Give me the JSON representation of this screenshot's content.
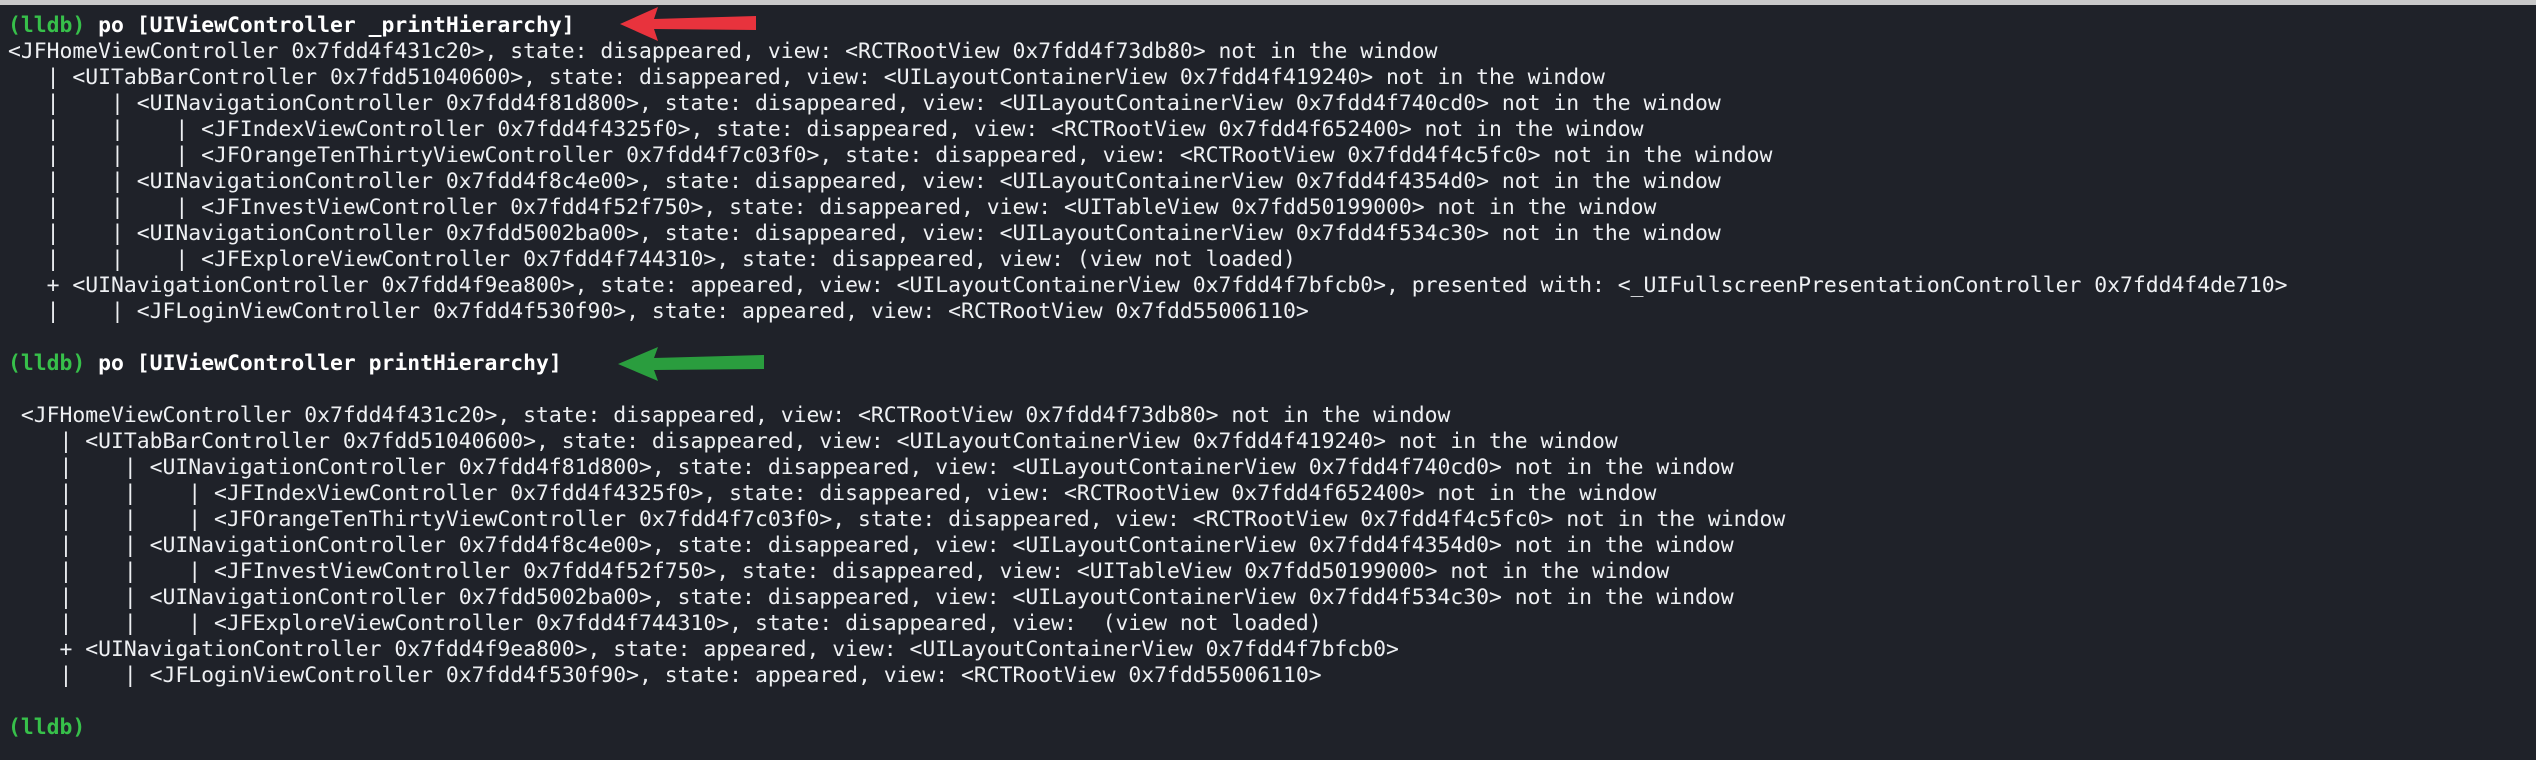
{
  "colors": {
    "background": "#1f2229",
    "prompt_green": "#37c04a",
    "text": "#eef0f3",
    "arrow_red": "#e8333d",
    "arrow_green": "#2a9d3e"
  },
  "icons": {
    "arrow1": "left-pointing-arrow-icon",
    "arrow2": "left-pointing-arrow-icon"
  },
  "console": {
    "prompt_label": "(lldb)",
    "block1": {
      "command": "po [UIViewController _printHierarchy]",
      "lines": [
        "<JFHomeViewController 0x7fdd4f431c20>, state: disappeared, view: <RCTRootView 0x7fdd4f73db80> not in the window",
        "   | <UITabBarController 0x7fdd51040600>, state: disappeared, view: <UILayoutContainerView 0x7fdd4f419240> not in the window",
        "   |    | <UINavigationController 0x7fdd4f81d800>, state: disappeared, view: <UILayoutContainerView 0x7fdd4f740cd0> not in the window",
        "   |    |    | <JFIndexViewController 0x7fdd4f4325f0>, state: disappeared, view: <RCTRootView 0x7fdd4f652400> not in the window",
        "   |    |    | <JFOrangeTenThirtyViewController 0x7fdd4f7c03f0>, state: disappeared, view: <RCTRootView 0x7fdd4f4c5fc0> not in the window",
        "   |    | <UINavigationController 0x7fdd4f8c4e00>, state: disappeared, view: <UILayoutContainerView 0x7fdd4f4354d0> not in the window",
        "   |    |    | <JFInvestViewController 0x7fdd4f52f750>, state: disappeared, view: <UITableView 0x7fdd50199000> not in the window",
        "   |    | <UINavigationController 0x7fdd5002ba00>, state: disappeared, view: <UILayoutContainerView 0x7fdd4f534c30> not in the window",
        "   |    |    | <JFExploreViewController 0x7fdd4f744310>, state: disappeared, view: (view not loaded)",
        "   + <UINavigationController 0x7fdd4f9ea800>, state: appeared, view: <UILayoutContainerView 0x7fdd4f7bfcb0>, presented with: <_UIFullscreenPresentationController 0x7fdd4f4de710>",
        "   |    | <JFLoginViewController 0x7fdd4f530f90>, state: appeared, view: <RCTRootView 0x7fdd55006110>"
      ]
    },
    "block2": {
      "command": "po [UIViewController printHierarchy]",
      "lines": [
        " <JFHomeViewController 0x7fdd4f431c20>, state: disappeared, view: <RCTRootView 0x7fdd4f73db80> not in the window",
        "    | <UITabBarController 0x7fdd51040600>, state: disappeared, view: <UILayoutContainerView 0x7fdd4f419240> not in the window",
        "    |    | <UINavigationController 0x7fdd4f81d800>, state: disappeared, view: <UILayoutContainerView 0x7fdd4f740cd0> not in the window",
        "    |    |    | <JFIndexViewController 0x7fdd4f4325f0>, state: disappeared, view: <RCTRootView 0x7fdd4f652400> not in the window",
        "    |    |    | <JFOrangeTenThirtyViewController 0x7fdd4f7c03f0>, state: disappeared, view: <RCTRootView 0x7fdd4f4c5fc0> not in the window",
        "    |    | <UINavigationController 0x7fdd4f8c4e00>, state: disappeared, view: <UILayoutContainerView 0x7fdd4f4354d0> not in the window",
        "    |    |    | <JFInvestViewController 0x7fdd4f52f750>, state: disappeared, view: <UITableView 0x7fdd50199000> not in the window",
        "    |    | <UINavigationController 0x7fdd5002ba00>, state: disappeared, view: <UILayoutContainerView 0x7fdd4f534c30> not in the window",
        "    |    |    | <JFExploreViewController 0x7fdd4f744310>, state: disappeared, view:  (view not loaded)",
        "    + <UINavigationController 0x7fdd4f9ea800>, state: appeared, view: <UILayoutContainerView 0x7fdd4f7bfcb0>",
        "    |    | <JFLoginViewController 0x7fdd4f530f90>, state: appeared, view: <RCTRootView 0x7fdd55006110>"
      ]
    }
  }
}
